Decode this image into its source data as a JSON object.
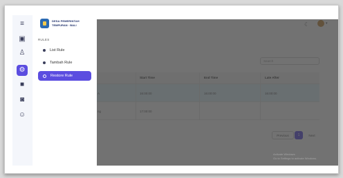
{
  "rail": {
    "icons": [
      "menu-icon",
      "calendar-icon",
      "user-icon",
      "settings-icon",
      "qr-icon",
      "image-icon",
      "smile-icon"
    ]
  },
  "brand": {
    "line1": "DESA PEMERINTAH",
    "line2": "TEMPURAN · BALI"
  },
  "sidebar": {
    "section": "RULES",
    "items": [
      {
        "label": "List Rule",
        "active": false
      },
      {
        "label": "Tambah Rule",
        "active": false
      },
      {
        "label": "Restore Rule",
        "active": true
      }
    ]
  },
  "search": {
    "placeholder": "Search"
  },
  "table": {
    "columns": [
      "",
      "Start Time",
      "End Time",
      "Late After"
    ],
    "rows": [
      [
        "A",
        "16:00:00",
        "16:00:00",
        "16:00:00"
      ],
      [
        "ng",
        "17:00:00",
        "",
        ""
      ]
    ]
  },
  "pagination": {
    "prev": "Previous",
    "current": "1",
    "next": "Next"
  },
  "watermark": {
    "line1": "Activate Windows",
    "line2": "Go to Settings to activate Windows."
  },
  "colors": {
    "accent": "#5b4de0",
    "selected_row": "#dff2fb"
  }
}
